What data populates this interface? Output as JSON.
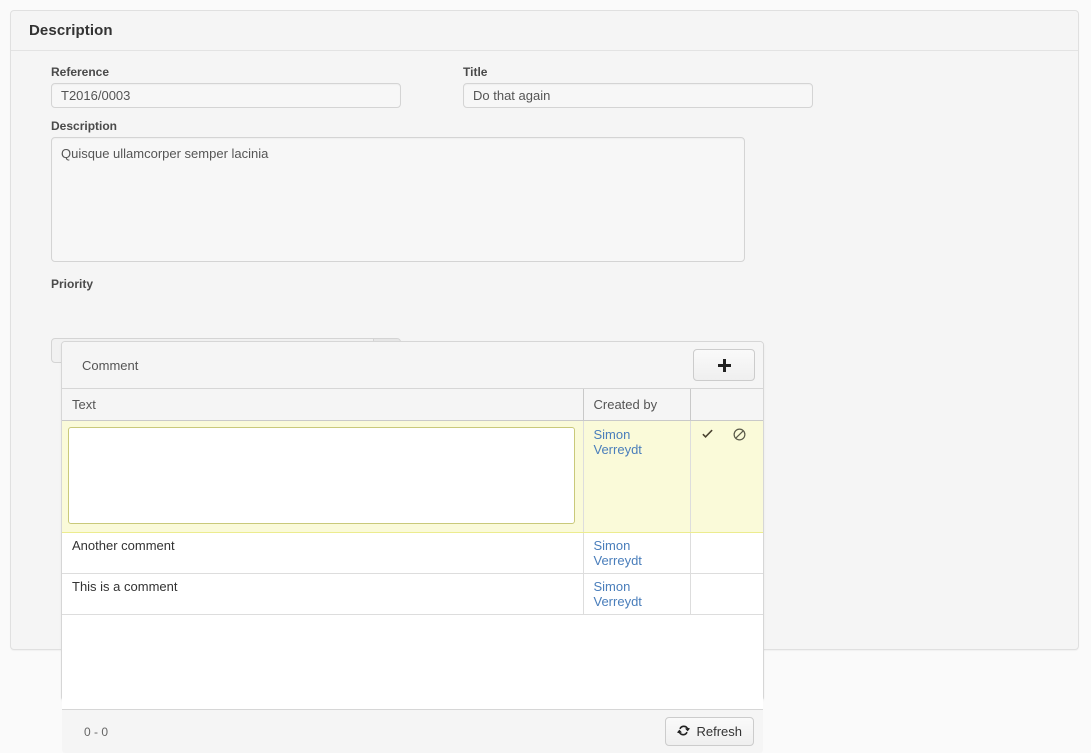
{
  "panel": {
    "title": "Description"
  },
  "form": {
    "reference": {
      "label": "Reference",
      "value": "T2016/0003",
      "placeholder": ""
    },
    "title": {
      "label": "Title",
      "value": "Do that again",
      "placeholder": ""
    },
    "description": {
      "label": "Description",
      "value": "Quisque ullamcorper semper lacinia",
      "placeholder": ""
    },
    "priority": {
      "label": "Priority",
      "value": ""
    }
  },
  "comment_panel": {
    "header_title": "Comment",
    "add_button_label": "+",
    "add_icon": "plus-icon",
    "columns": [
      {
        "key": "text",
        "label": "Text"
      },
      {
        "key": "created_by",
        "label": "Created by"
      },
      {
        "key": "actions",
        "label": ""
      }
    ],
    "edit_row": {
      "text_value": "",
      "text_placeholder": "",
      "created_by": "Simon Verreydt",
      "accept_icon": "check-icon",
      "cancel_icon": "ban-icon"
    },
    "rows": [
      {
        "text": "Another comment",
        "created_by": "Simon Verreydt"
      },
      {
        "text": "This is a comment",
        "created_by": "Simon Verreydt"
      }
    ],
    "footer": {
      "count": "0 - 0",
      "refresh_label": "Refresh",
      "refresh_icon": "refresh-icon"
    }
  },
  "colors": {
    "link": "#4a7ebb",
    "row_highlight": "#fafad9",
    "panel_bg": "#f5f5f5"
  }
}
